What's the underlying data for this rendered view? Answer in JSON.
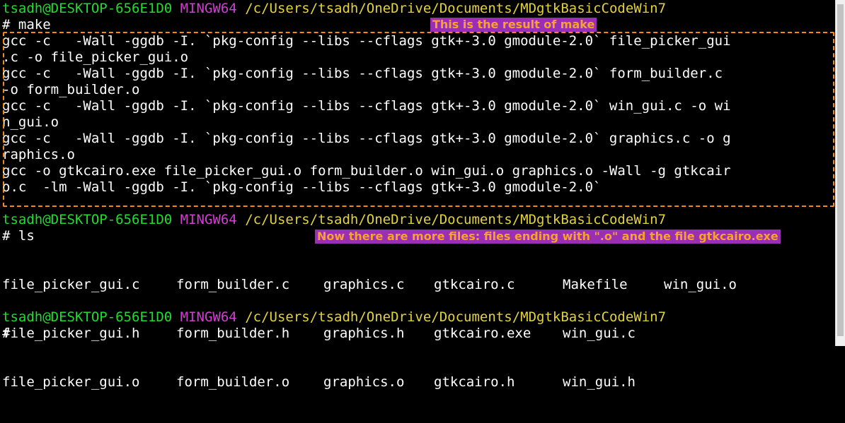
{
  "prompts": [
    {
      "user": "tsadh@DESKTOP-656E1D0",
      "shell": "MINGW64",
      "path": "/c/Users/tsadh/OneDrive/Documents/MDgtkBasicCodeWin7"
    },
    {
      "user": "tsadh@DESKTOP-656E1D0",
      "shell": "MINGW64",
      "path": "/c/Users/tsadh/OneDrive/Documents/MDgtkBasicCodeWin7"
    },
    {
      "user": "tsadh@DESKTOP-656E1D0",
      "shell": "MINGW64",
      "path": "/c/Users/tsadh/OneDrive/Documents/MDgtkBasicCodeWin7"
    }
  ],
  "commands": {
    "make": "# make",
    "ls": "# ls",
    "empty": "#"
  },
  "make_output": [
    "gcc -c   -Wall -ggdb -I. `pkg-config --libs --cflags gtk+-3.0 gmodule-2.0` file_picker_gui",
    ".c -o file_picker_gui.o",
    "gcc -c   -Wall -ggdb -I. `pkg-config --libs --cflags gtk+-3.0 gmodule-2.0` form_builder.c",
    "-o form_builder.o",
    "gcc -c   -Wall -ggdb -I. `pkg-config --libs --cflags gtk+-3.0 gmodule-2.0` win_gui.c -o wi",
    "n_gui.o",
    "gcc -c   -Wall -ggdb -I. `pkg-config --libs --cflags gtk+-3.0 gmodule-2.0` graphics.c -o g",
    "raphics.o",
    "gcc -o gtkcairo.exe file_picker_gui.o form_builder.o win_gui.o graphics.o -Wall -g gtkcair",
    "o.c  -lm -Wall -ggdb -I. `pkg-config --libs --cflags gtk+-3.0 gmodule-2.0`"
  ],
  "ls_output": {
    "col1": [
      "file_picker_gui.c",
      "file_picker_gui.h",
      "file_picker_gui.o"
    ],
    "col2": [
      "form_builder.c",
      "form_builder.h",
      "form_builder.o"
    ],
    "col3": [
      "graphics.c",
      "graphics.h",
      "graphics.o"
    ],
    "col4": [
      "gtkcairo.c",
      "gtkcairo.exe",
      "gtkcairo.h"
    ],
    "col5": [
      "Makefile",
      "win_gui.c",
      "win_gui.h"
    ],
    "col6": [
      "win_gui.o"
    ]
  },
  "annotations": {
    "make_note": "This is the result of make",
    "ls_note": "Now there are more files: files ending with \".o\" and the file gtkcairo.exe"
  },
  "colors": {
    "user": "#1fdc2f",
    "shell": "#d03fcf",
    "path": "#e3d33b",
    "highlight_border": "#f08b1a",
    "callout_bg": "#9a2fb4",
    "callout_text": "#f8a12e"
  }
}
